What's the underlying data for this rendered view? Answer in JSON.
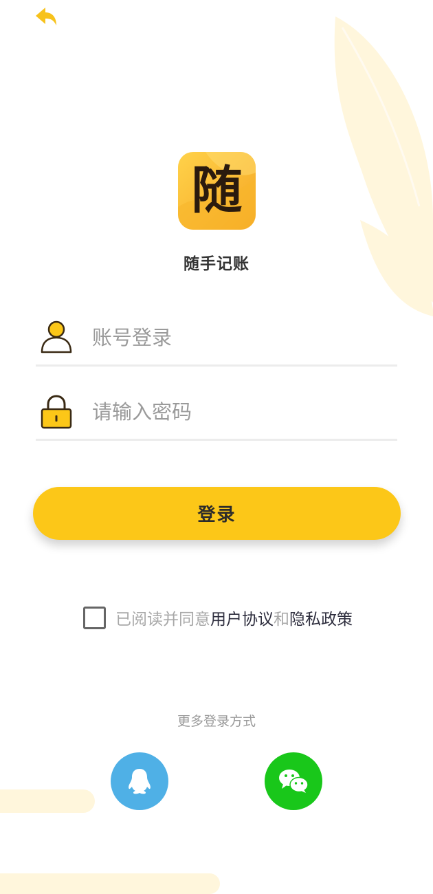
{
  "app": {
    "name": "随手记账",
    "icon_char": "随"
  },
  "login_form": {
    "account_placeholder": "账号登录",
    "password_placeholder": "请输入密码",
    "login_button_label": "登录"
  },
  "agreement": {
    "checked": false,
    "prefix_text": "已阅读并同意",
    "user_agreement_link": "用户协议",
    "connector_text": "和",
    "privacy_policy_link": "隐私政策"
  },
  "other_login": {
    "title": "更多登录方式",
    "methods": [
      {
        "name": "qq",
        "icon": "qq-penguin-icon",
        "color": "#4fb0e6"
      },
      {
        "name": "wechat",
        "icon": "wechat-icon",
        "color": "#19c71a"
      }
    ]
  },
  "colors": {
    "accent": "#fcc718",
    "back_arrow": "#f7c21c",
    "decoration": "#fff6dc",
    "divider": "#ececec"
  },
  "icons": {
    "back": "back-arrow-icon",
    "account": "user-icon",
    "password": "lock-icon"
  }
}
